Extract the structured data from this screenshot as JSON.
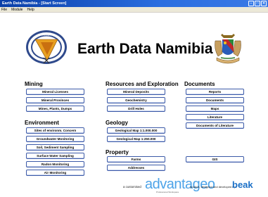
{
  "window": {
    "title": "Earth Data Namibia - [Start Screen]",
    "controls": [
      "–",
      "□",
      "✕"
    ]
  },
  "menu": [
    "File",
    "Module",
    "Help"
  ],
  "header": {
    "title": "Earth Data Namibia",
    "ring_text": "NAMIBIA"
  },
  "sections": {
    "mining": {
      "title": "Mining",
      "buttons": [
        "Mineral Licenses",
        "Mineral Provinces",
        "Mines, Plants, Dumps"
      ]
    },
    "environment": {
      "title": "Environment",
      "buttons": [
        "Sites of environm. Concern",
        "Groundwater Monitoring",
        "Soil, Sediment Sampling",
        "Surface Water Sampling",
        "Radon Monitoring",
        "Air Monitoring"
      ]
    },
    "resources": {
      "title": "Resources and Exploration",
      "buttons": [
        "Mineral Deposits",
        "Geochemistry",
        "Drill Holes"
      ]
    },
    "geology": {
      "title": "Geology",
      "buttons": [
        "Geological Map 1:1.000.000",
        "Geological Map 1:250.000"
      ]
    },
    "property": {
      "title": "Property",
      "buttons": [
        "Farms",
        "Addresses"
      ]
    },
    "documents": {
      "title": "Documents",
      "buttons": [
        "Reports",
        "Documents",
        "Maps",
        "Literature",
        "Documents of Literature"
      ]
    },
    "gis": {
      "button": "GIS"
    }
  },
  "footer": {
    "prefix": "a customised",
    "product": "advantageo",
    "product_sub": "Professional Workspace",
    "suffix": "product, designed and developed by",
    "company": "beak"
  },
  "colors": {
    "title_bar": "#0a3fa8",
    "button_border": "#3c5aa8",
    "brand_blue": "#4da3e8"
  }
}
